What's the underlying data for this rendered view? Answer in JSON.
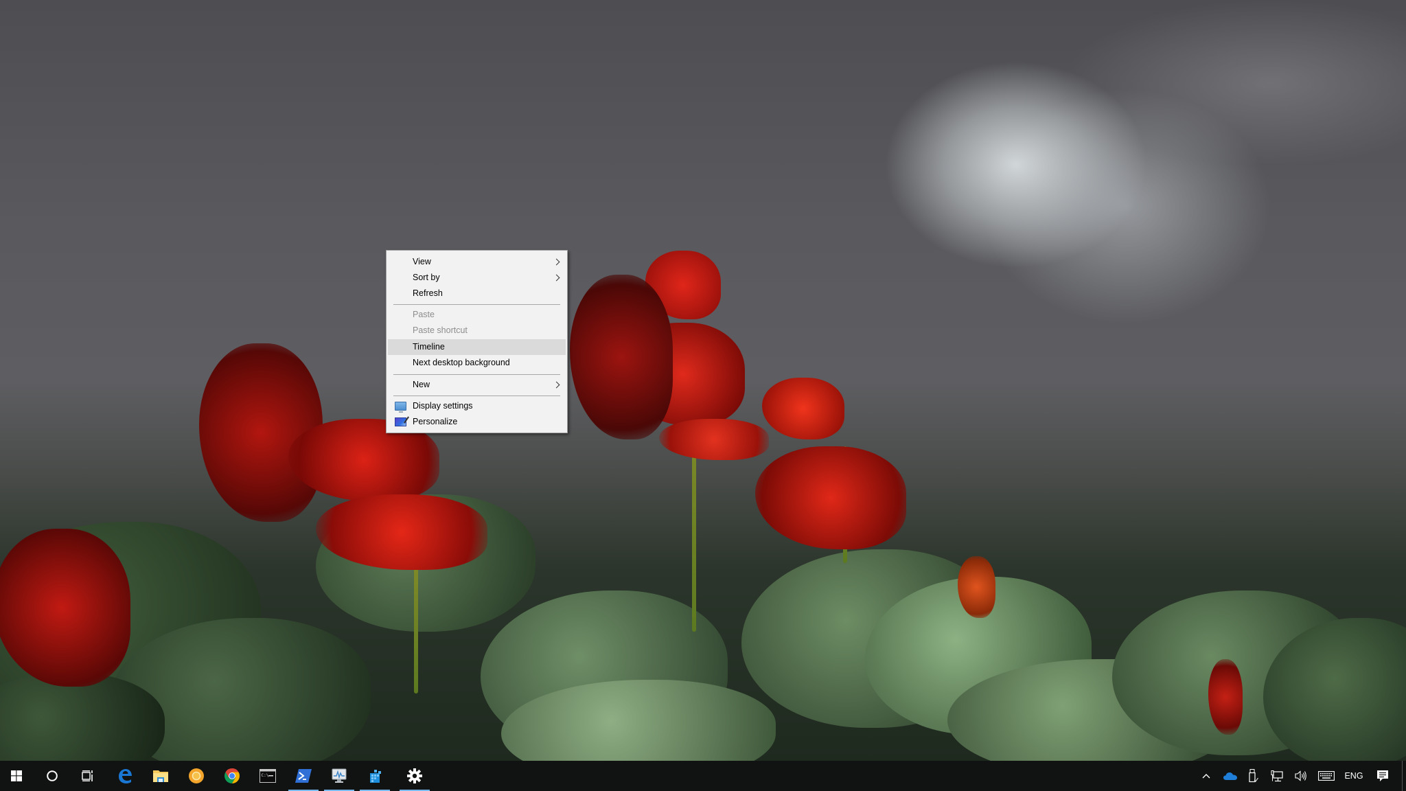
{
  "desktop": {
    "wallpaper": "red-salvia-flowers-with-green-leaves"
  },
  "context_menu": {
    "items": [
      {
        "label": "View",
        "has_submenu": true,
        "disabled": false
      },
      {
        "label": "Sort by",
        "has_submenu": true,
        "disabled": false
      },
      {
        "label": "Refresh",
        "has_submenu": false,
        "disabled": false
      },
      {
        "label": "Paste",
        "has_submenu": false,
        "disabled": true
      },
      {
        "label": "Paste shortcut",
        "has_submenu": false,
        "disabled": true
      },
      {
        "label": "Timeline",
        "has_submenu": false,
        "disabled": false,
        "highlighted": true
      },
      {
        "label": "Next desktop background",
        "has_submenu": false,
        "disabled": false
      },
      {
        "label": "New",
        "has_submenu": true,
        "disabled": false
      },
      {
        "label": "Display settings",
        "icon": "display-settings-icon",
        "disabled": false
      },
      {
        "label": "Personalize",
        "icon": "personalize-icon",
        "disabled": false
      }
    ]
  },
  "taskbar": {
    "pinned": [
      {
        "name": "start",
        "icon": "windows-logo-icon"
      },
      {
        "name": "cortana",
        "icon": "cortana-circle-icon"
      },
      {
        "name": "task-view",
        "icon": "task-view-icon"
      },
      {
        "name": "edge",
        "icon": "edge-icon"
      },
      {
        "name": "file-explorer",
        "icon": "folder-icon"
      },
      {
        "name": "chrome-canary",
        "icon": "chrome-canary-icon"
      },
      {
        "name": "chrome",
        "icon": "chrome-icon"
      },
      {
        "name": "command-prompt",
        "icon": "cmd-icon"
      },
      {
        "name": "powershell",
        "icon": "powershell-icon",
        "active": true
      },
      {
        "name": "performance-monitor",
        "icon": "performance-monitor-icon",
        "active": true
      },
      {
        "name": "app-blocks",
        "icon": "blocks-app-icon",
        "active": true
      },
      {
        "name": "settings",
        "icon": "gear-icon",
        "active": true
      }
    ],
    "tray": {
      "chevron": "show-hidden-icons",
      "onedrive": "onedrive-cloud-icon",
      "usb": "safely-remove-hardware-icon",
      "network": "network-icon",
      "volume": "volume-icon",
      "keyboard": "touch-keyboard-icon",
      "language": "ENG",
      "action_center": "action-center-icon"
    }
  },
  "colors": {
    "menu_bg": "#f2f2f2",
    "menu_highlight": "#dadada",
    "menu_disabled_text": "#8d8d8d",
    "taskbar_bg": "#101312",
    "active_indicator": "#76b9ed"
  }
}
